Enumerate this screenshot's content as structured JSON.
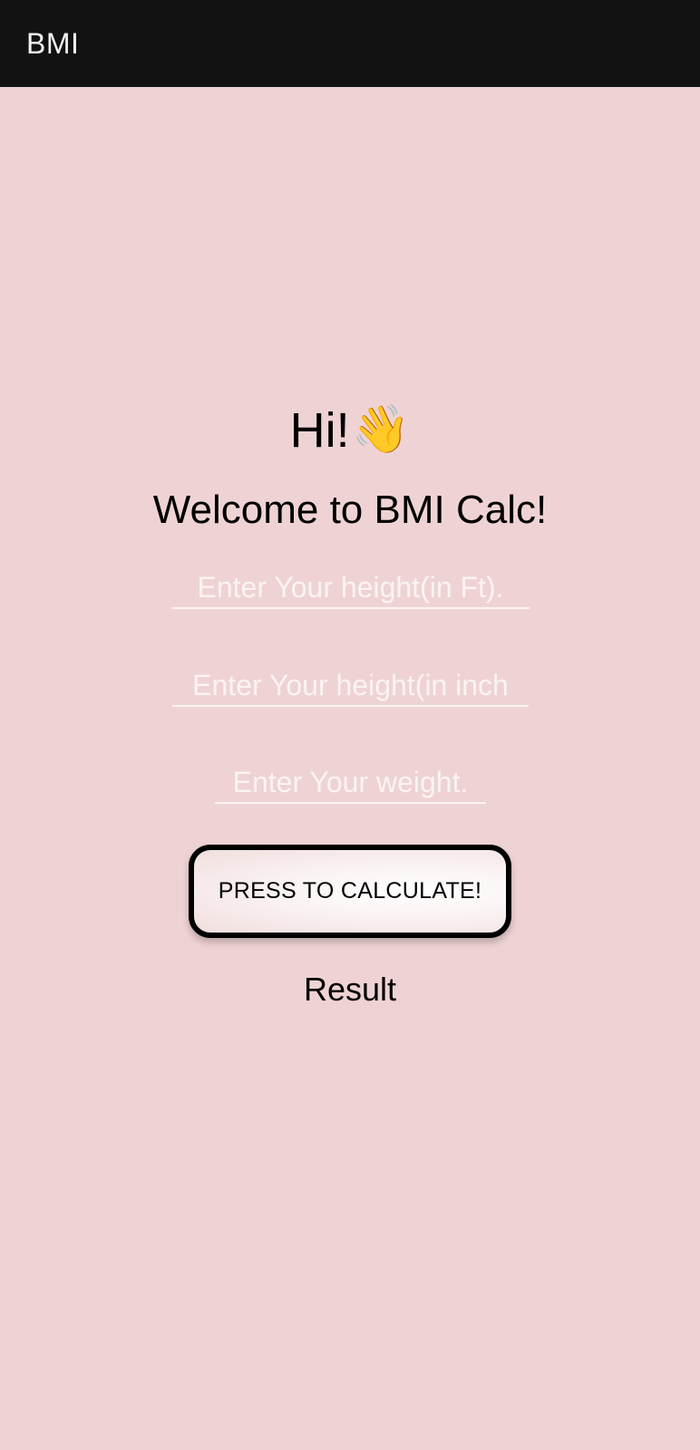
{
  "app_bar": {
    "title": "BMI"
  },
  "main": {
    "greeting": "Hi!",
    "greeting_icon": "👋",
    "welcome": "Welcome to BMI Calc!",
    "height_ft_field": {
      "value": "",
      "placeholder": "Enter Your height(in Ft)."
    },
    "height_in_field": {
      "value": "",
      "placeholder": "Enter Your height(in inch"
    },
    "weight_field": {
      "value": "",
      "placeholder": "Enter Your weight."
    },
    "calculate_button_label": "PRESS TO CALCULATE!",
    "result_label": "Result"
  },
  "colors": {
    "app_bar_background": "#121212",
    "app_bar_text": "#f2f2f2",
    "page_background": "#efd3d4",
    "field_text": "#fbf3f3",
    "button_border": "#000000"
  },
  "icons": {
    "greeting": "waving-hand-icon"
  }
}
